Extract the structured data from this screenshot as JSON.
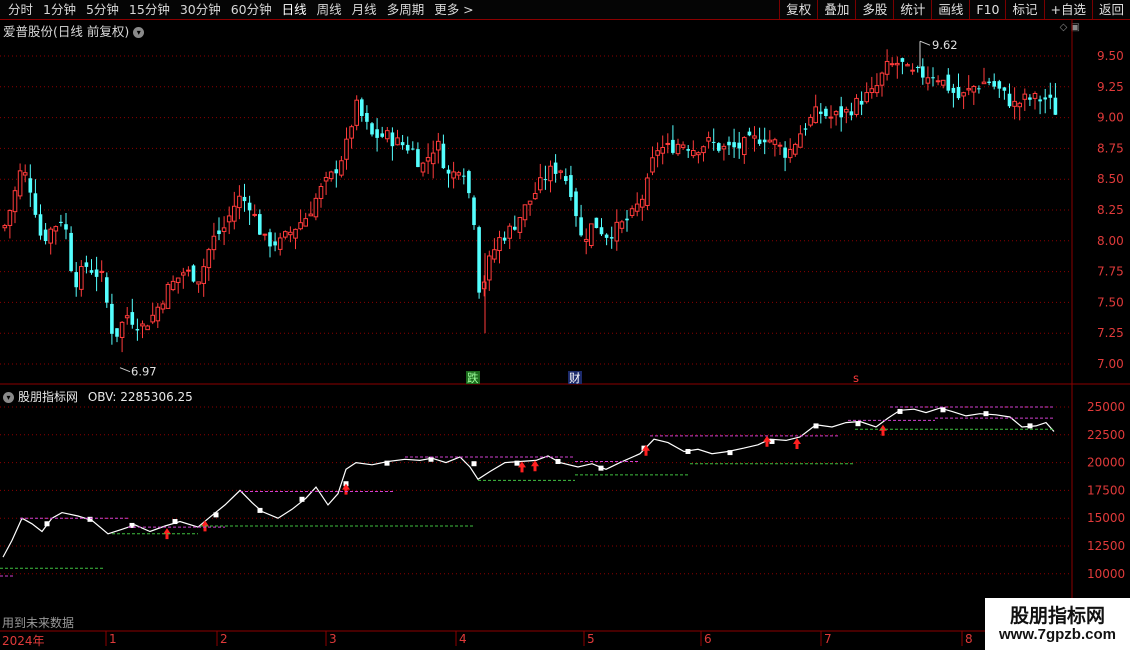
{
  "toolbar": {
    "periods": [
      "分时",
      "1分钟",
      "5分钟",
      "15分钟",
      "30分钟",
      "60分钟",
      "日线",
      "周线",
      "月线",
      "多周期",
      "更多 >"
    ],
    "active_period": "日线",
    "buttons": [
      "复权",
      "叠加",
      "多股",
      "统计",
      "画线",
      "F10",
      "标记",
      "+自选",
      "返回"
    ]
  },
  "main_chart": {
    "title": "爱普股份(日线 前复权)",
    "price_axis": [
      "9.50",
      "9.25",
      "9.00",
      "8.75",
      "8.50",
      "8.25",
      "8.00",
      "7.75",
      "7.50",
      "7.25",
      "7.00"
    ],
    "high_label": "9.62",
    "low_label": "6.97",
    "markers": [
      "跌",
      "财",
      "s"
    ],
    "colors": {
      "up": "#ff3b3b",
      "down": "#54ffff",
      "grid": "#8b0000"
    }
  },
  "indicator": {
    "title": "股朋指标网",
    "obv_label": "OBV:",
    "obv_value": "2285306.25",
    "axis": [
      "25000",
      "22500",
      "20000",
      "17500",
      "15000",
      "12500",
      "10000"
    ],
    "future_note": "用到未来数据"
  },
  "time_axis": {
    "year": "2024年",
    "months": [
      "1",
      "2",
      "3",
      "4",
      "5",
      "6",
      "7",
      "8"
    ]
  },
  "watermark": {
    "line1": "股朋指标网",
    "line2": "www.7gpzb.com"
  }
}
